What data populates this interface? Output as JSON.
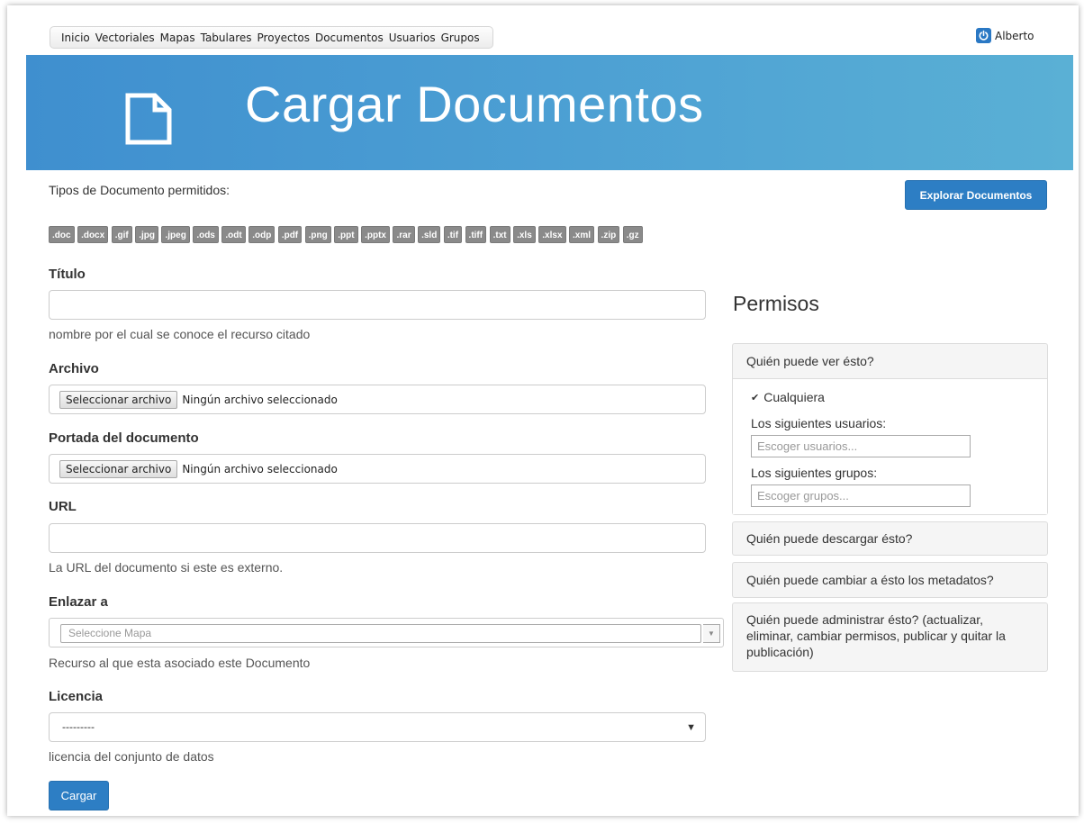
{
  "nav": {
    "items": [
      "Inicio",
      "Vectoriales",
      "Mapas",
      "Tabulares",
      "Proyectos",
      "Documentos",
      "Usuarios",
      "Grupos"
    ],
    "user": "Alberto"
  },
  "header": {
    "title": "Cargar Documentos"
  },
  "upload": {
    "types_label": "Tipos de Documento permitidos:",
    "explore_button": "Explorar Documentos",
    "types": [
      ".doc",
      ".docx",
      ".gif",
      ".jpg",
      ".jpeg",
      ".ods",
      ".odt",
      ".odp",
      ".pdf",
      ".png",
      ".ppt",
      ".pptx",
      ".rar",
      ".sld",
      ".tif",
      ".tiff",
      ".txt",
      ".xls",
      ".xlsx",
      ".xml",
      ".zip",
      ".gz"
    ]
  },
  "form": {
    "title_label": "Título",
    "title_value": "",
    "title_help": "nombre por el cual se conoce el recurso citado",
    "file_label": "Archivo",
    "file_button": "Seleccionar archivo",
    "file_status": "Ningún archivo seleccionado",
    "cover_label": "Portada del documento",
    "cover_button": "Seleccionar archivo",
    "cover_status": "Ningún archivo seleccionado",
    "url_label": "URL",
    "url_value": "",
    "url_help": "La URL del documento si este es externo.",
    "link_label": "Enlazar a",
    "link_placeholder": "Seleccione Mapa",
    "link_help": "Recurso al que esta asociado este Documento",
    "license_label": "Licencia",
    "license_value": "---------",
    "license_help": "licencia del conjunto de datos",
    "submit": "Cargar"
  },
  "permissions": {
    "title": "Permisos",
    "view": {
      "heading": "Quién puede ver ésto?",
      "anyone": "Cualquiera",
      "anyone_checked": true,
      "users_label": "Los siguientes usuarios:",
      "users_placeholder": "Escoger usuarios...",
      "groups_label": "Los siguientes grupos:",
      "groups_placeholder": "Escoger grupos..."
    },
    "download": "Quién puede descargar ésto?",
    "metadata": "Quién puede cambiar a ésto los metadatos?",
    "manage": "Quién puede administrar ésto? (actualizar, eliminar, cambiar permisos, publicar y quitar la publicación)"
  },
  "colors": {
    "accent": "#2d7ec4",
    "banner": "#4c9fd3",
    "badge": "#8a8a8a"
  }
}
